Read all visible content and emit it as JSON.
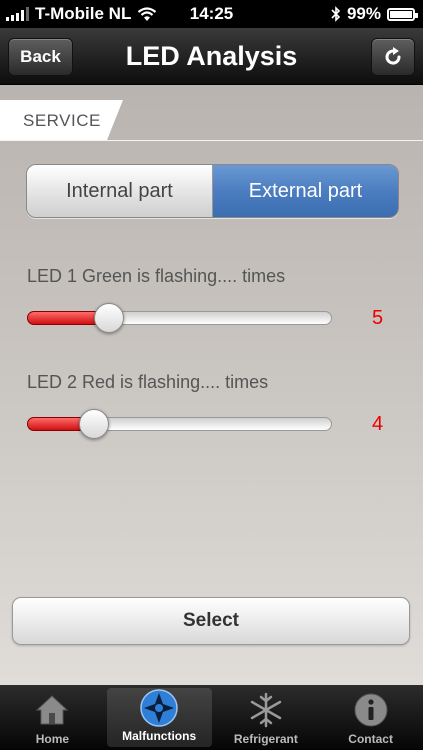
{
  "status_bar": {
    "carrier": "T-Mobile NL",
    "time": "14:25",
    "battery": "99%"
  },
  "nav": {
    "title": "LED Analysis",
    "back_label": "Back"
  },
  "section": {
    "label": "SERVICE"
  },
  "segments": [
    {
      "label": "Internal part",
      "selected": false
    },
    {
      "label": "External part",
      "selected": true
    }
  ],
  "leds": [
    {
      "label": "LED 1 Green is flashing.... times",
      "value": "5",
      "fraction": 0.27
    },
    {
      "label": "LED 2 Red is flashing.... times",
      "value": "4",
      "fraction": 0.22
    }
  ],
  "select_label": "Select",
  "tabs": [
    {
      "label": "Home",
      "icon": "home-icon",
      "active": false
    },
    {
      "label": "Malfunctions",
      "icon": "malfunctions-icon",
      "active": true
    },
    {
      "label": "Refrigerant",
      "icon": "snowflake-icon",
      "active": false
    },
    {
      "label": "Contact",
      "icon": "info-icon",
      "active": false
    }
  ],
  "colors": {
    "accent": "#4b7dc0",
    "slider_fill": "#d11010",
    "count": "#e00000"
  }
}
